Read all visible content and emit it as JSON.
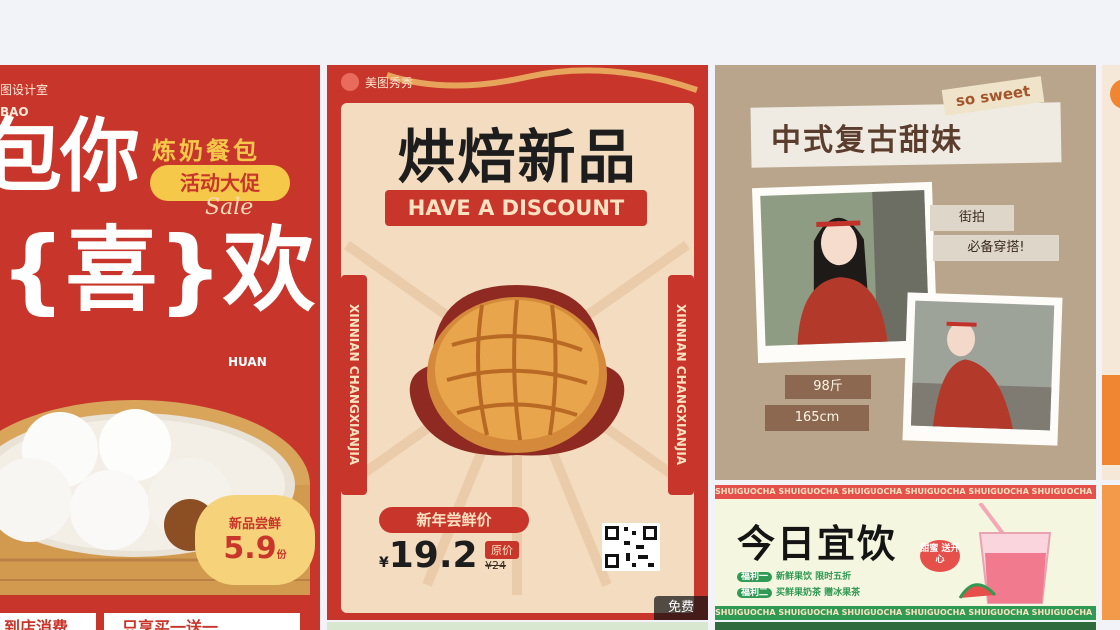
{
  "cards": [
    {
      "id": "buns",
      "brand": "图设计室",
      "brand_sub": "BAO",
      "headline_line1": "包你",
      "headline_line2": "{喜}欢",
      "subtitle": "炼奶餐包",
      "promo_pill": "活动大促",
      "script_text": "Sale",
      "huan": "HUAN",
      "badge_title": "新品尝鲜",
      "badge_price": "5.9",
      "badge_unit": "份",
      "bottom_left": "到店消费",
      "bottom_right": "只享买一送一"
    },
    {
      "id": "bakery",
      "brand": "美图秀秀",
      "title": "烘焙新品",
      "ribbon": "HAVE A DISCOUNT",
      "vertical_left": "XINNIAN CHANGXIANJIA",
      "vertical_right": "XINNIAN CHANGXIANJIA",
      "price_label": "新年尝鲜价",
      "currency": "¥",
      "price": "19.2",
      "orig_label": "原价",
      "orig_price": "¥24",
      "free_badge": "免费"
    },
    {
      "id": "retro",
      "title": "中式复古甜妹",
      "tag": "so sweet",
      "note1": "街拍",
      "note2": "必备穿搭!",
      "weight": "98斤",
      "height": "165cm"
    },
    {
      "id": "drink",
      "strip_text": "SHUIGUOCHA   SHUIGUOCHA   SHUIGUOCHA   SHUIGUOCHA   SHUIGUOCHA   SHUIGUOCHA",
      "title": "今日宜饮",
      "tag": "甜蜜 送开心",
      "row1_label": "福利一",
      "row1_text": "新鲜果饮 限时五折",
      "row2_label": "福利二",
      "row2_text": "买鲜果奶茶 赠冰果茶"
    }
  ],
  "colors": {
    "page_bg": "#f1f3f8",
    "brand_red": "#c8352b",
    "cream": "#f3dcc0",
    "retro_bg": "#b9a58b",
    "drink_green": "#2f9a53"
  }
}
